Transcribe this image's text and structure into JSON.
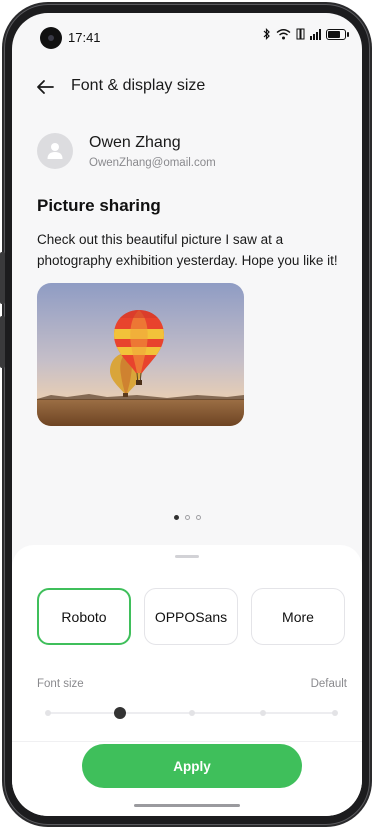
{
  "status_bar": {
    "time": "17:41"
  },
  "header": {
    "title": "Font & display size"
  },
  "user": {
    "name": "Owen Zhang",
    "email": "OwenZhang@omail.com"
  },
  "post": {
    "title": "Picture sharing",
    "body": "Check out this beautiful picture I saw at a photography exhibition yesterday. Hope you like it!"
  },
  "pager": {
    "count": 3,
    "active_index": 0
  },
  "fonts": [
    {
      "label": "Roboto",
      "selected": true
    },
    {
      "label": "OPPOSans",
      "selected": false
    },
    {
      "label": "More",
      "selected": false
    }
  ],
  "font_size": {
    "label": "Font size",
    "default_label": "Default",
    "steps": 5,
    "selected_step": 1
  },
  "apply": {
    "label": "Apply"
  },
  "colors": {
    "accent": "#3fbf5b",
    "sheet": "#ffffff",
    "background": "#f7f7f8"
  }
}
